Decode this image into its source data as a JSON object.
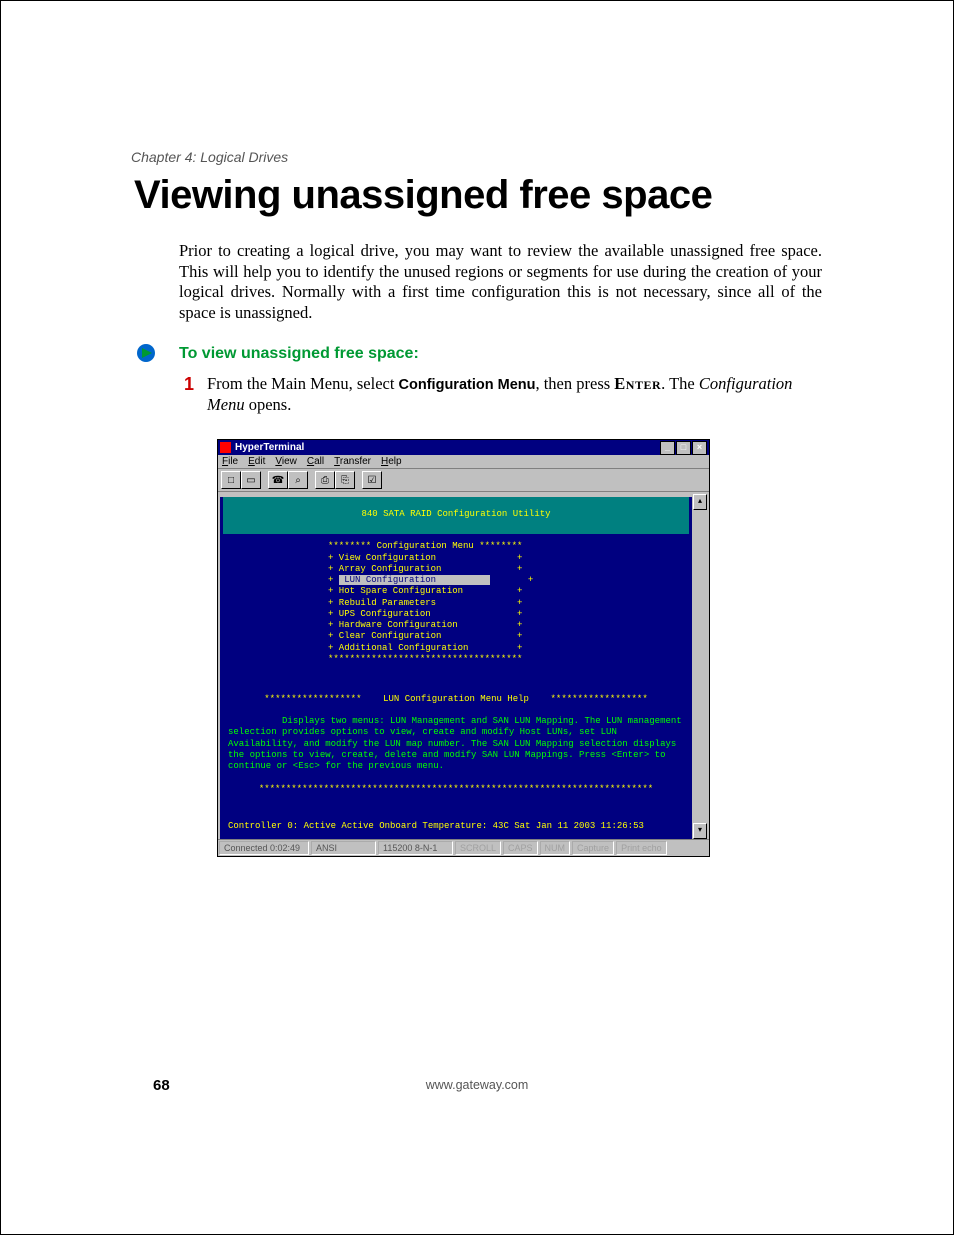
{
  "header": {
    "chapter": "Chapter 4: Logical Drives"
  },
  "title": "Viewing unassigned free space",
  "intro": "Prior to creating a logical drive, you may want to review the available unassigned free space. This will help you to identify the unused regions or segments for use during the creation of your logical drives. Normally with a first time configuration this is not necessary, since all of the space is unassigned.",
  "subheading": "To view unassigned free space:",
  "step": {
    "num": "1",
    "pre": "From the Main Menu, select ",
    "bold1": "Configuration Menu",
    "mid": ", then press ",
    "enter": "Enter",
    "post1": ". The ",
    "ital": "Configuration Menu",
    "post2": " opens."
  },
  "window": {
    "title": "HyperTerminal",
    "menus": {
      "file": "File",
      "edit": "Edit",
      "view": "View",
      "call": "Call",
      "transfer": "Transfer",
      "help": "Help"
    },
    "winbtns": {
      "min": "_",
      "max": "□",
      "close": "×"
    },
    "toolbar_icons": [
      "□",
      "▭",
      "☎",
      "⌕",
      "⎙",
      "⎘",
      "☑"
    ]
  },
  "terminal": {
    "banner": "840 SATA RAID Configuration Utility",
    "menu_header": "******** Configuration Menu ********",
    "items": [
      "View Configuration",
      "Array Configuration",
      "LUN Configuration",
      "Hot Spare Configuration",
      "Rebuild Parameters",
      "UPS Configuration",
      "Hardware Configuration",
      "Clear Configuration",
      "Additional Configuration"
    ],
    "selected_index": 2,
    "menu_footer": "************************************",
    "help_title": "******************    LUN Configuration Menu Help    ******************",
    "help_body": "Displays two menus: LUN Management and SAN LUN Mapping. The LUN management selection provides options to view, create and modify Host LUNs, set LUN Availability, and modify the LUN map number. The SAN LUN Mapping selection displays the options to view, create, delete and modify SAN LUN Mappings. Press <Enter> to continue or <Esc> for the previous menu.",
    "help_footer": "*************************************************************************",
    "status": "Controller 0:  Active Active    Onboard Temperature: 43C    Sat Jan 11 2003  11:26:53"
  },
  "statusbar": {
    "connected": "Connected 0:02:49",
    "emu": "ANSI",
    "baud": "115200 8-N-1",
    "scroll": "SCROLL",
    "caps": "CAPS",
    "num": "NUM",
    "capture": "Capture",
    "echo": "Print echo"
  },
  "footer": {
    "page": "68",
    "url": "www.gateway.com"
  }
}
